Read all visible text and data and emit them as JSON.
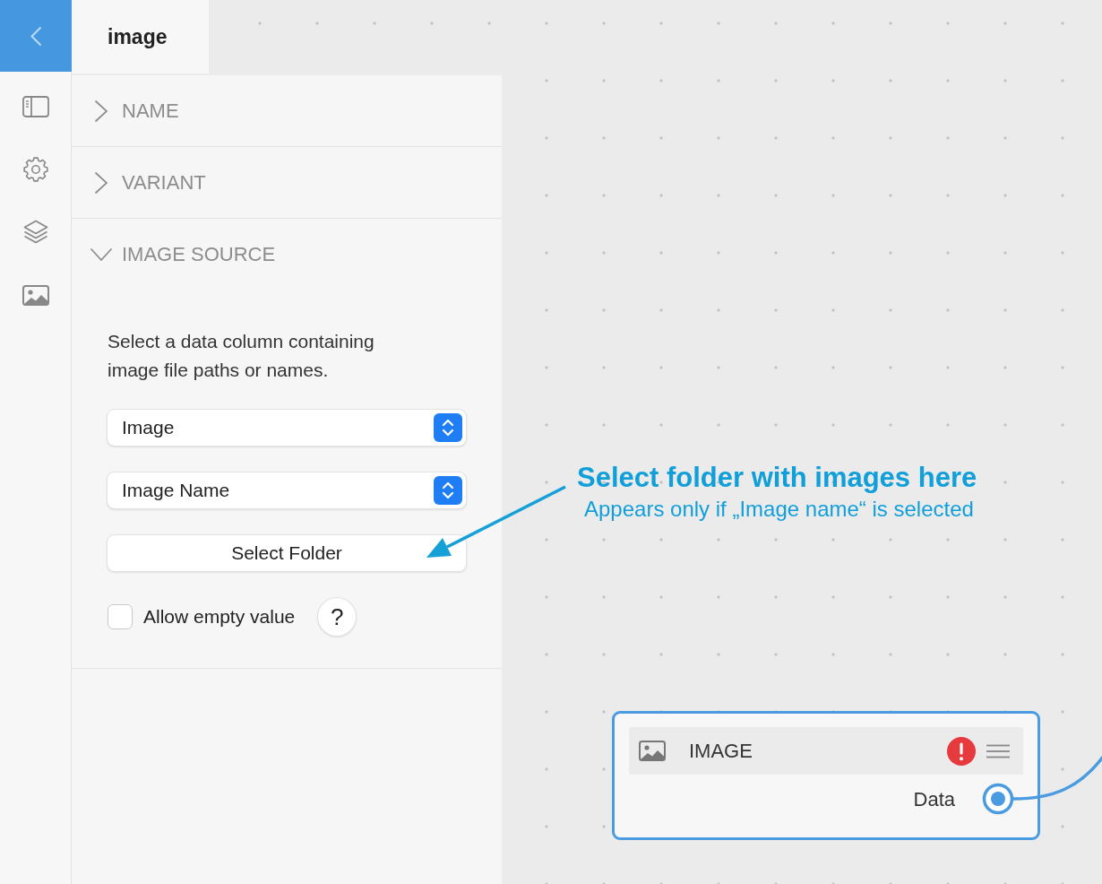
{
  "tab": {
    "title": "image"
  },
  "sections": [
    {
      "title": "NAME",
      "expanded": false
    },
    {
      "title": "VARIANT",
      "expanded": false
    },
    {
      "title": "IMAGE SOURCE",
      "expanded": true,
      "description": "Select a data column containing image file paths or names.",
      "controls": [
        {
          "kind": "select",
          "value": "Image"
        },
        {
          "kind": "select",
          "value": "Image Name"
        },
        {
          "kind": "button",
          "label": "Select Folder"
        },
        {
          "kind": "checkbox",
          "label": "Allow empty value",
          "checked": false,
          "help": "?"
        }
      ]
    }
  ],
  "annotation": {
    "title": "Select folder with images here",
    "subtitle": "Appears only if „Image name“ is selected"
  },
  "node": {
    "title": "IMAGE",
    "error": true,
    "outputs": [
      {
        "label": "Data",
        "connected": true
      }
    ]
  }
}
